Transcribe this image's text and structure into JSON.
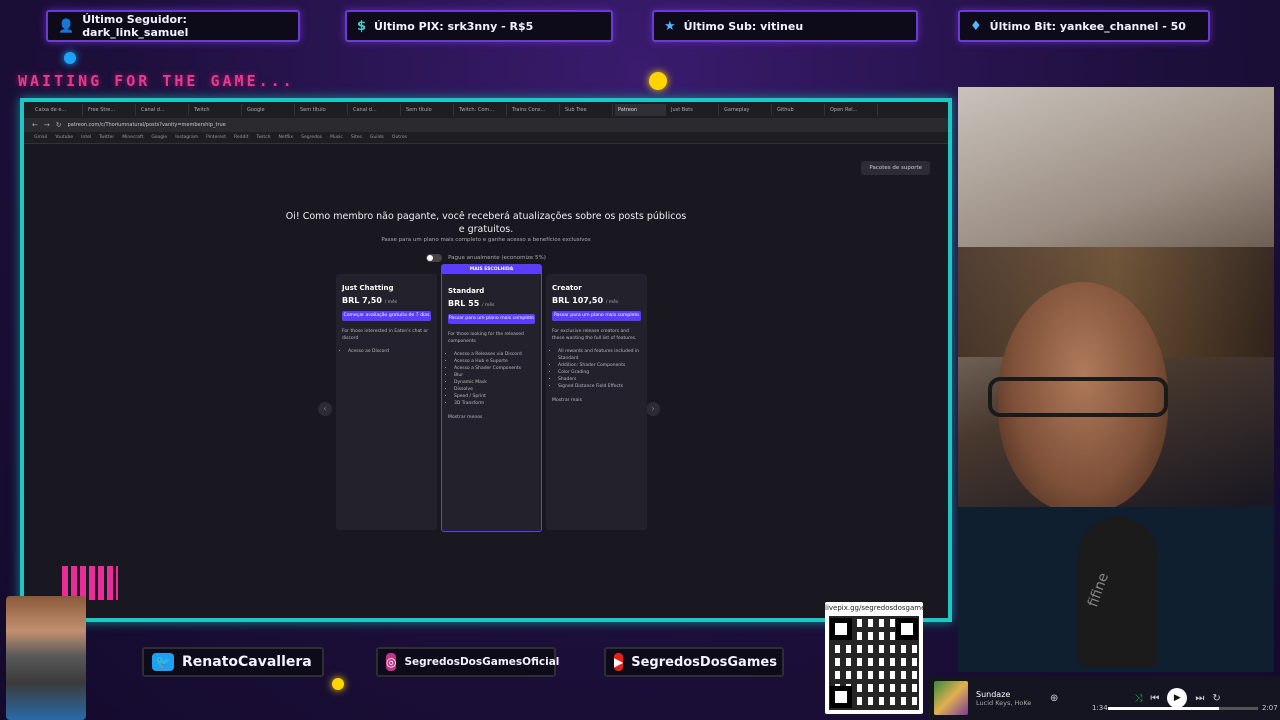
{
  "alerts": {
    "follower": "Último Seguidor: dark_link_samuel",
    "pix": "Último PIX: srk3nny - R$5",
    "sub": "Último Sub: vitineu",
    "bit": "Último Bit: yankee_channel - 50"
  },
  "waiting_text": "WAITING FOR THE GAME...",
  "browser": {
    "tabs": [
      "Caixa de e...",
      "Free Stre...",
      "Canal d...",
      "Twitch",
      "Google",
      "Sem título",
      "Canal d...",
      "Sem título",
      "Twitch: Com...",
      "Trains Cons...",
      "Sub Tree",
      "Patreon",
      "Just Bets",
      "Gameplay",
      "Github",
      "Open Rel..."
    ],
    "url": "patreon.com/c/Thoriumnatural/posts?vanity=membership_true",
    "bookmarks": [
      "Gmail",
      "Youtube",
      "Intel",
      "Twitter",
      "Minecraft",
      "Google",
      "Instagram",
      "Pinterest",
      "Reddit",
      "Twitch",
      "Netflix",
      "Segredos",
      "Music",
      "Sites",
      "Guilds",
      "Outros"
    ]
  },
  "page": {
    "top_button": "Pacotes de suporte",
    "headline_line1": "Oi! Como membro não pagante, você receberá atualizações sobre os posts públicos",
    "headline_line2": "e gratuitos.",
    "subline": "Passe para um plano mais completo e ganhe acesso a benefícios exclusivos",
    "toggle_label": "Pague anualmente (economize 5%)",
    "cards": [
      {
        "flag": "",
        "name": "Just Chatting",
        "price": "BRL 7,50",
        "per": "/ mês",
        "cta": "Começar avaliação gratuita de 7 dias",
        "desc": "For those interested in Eaton's chat or discord",
        "list": [
          "Acesso ao Discord"
        ],
        "more": ""
      },
      {
        "flag": "MAIS ESCOLHIDA",
        "name": "Standard",
        "price": "BRL 55",
        "per": "/ mês",
        "cta": "Passar para um plano mais completo",
        "desc": "For those looking for the released components",
        "list": [
          "Acesso a Releases via Discord",
          "Acesso a Hub e Suporte",
          "Acesso a Shader Components",
          "Blur",
          "Dynamic Mask",
          "Dissolve",
          "Speed / Sprint",
          "3D Transform"
        ],
        "more": "Mostrar menos"
      },
      {
        "flag": "",
        "name": "Creator",
        "price": "BRL 107,50",
        "per": "/ mês",
        "cta": "Passar para um plano mais completo",
        "desc": "For exclusive release creators and those wanting the full list of features.",
        "list": [
          "All rewards and features included in Standard",
          "Addition: Shader Components",
          "Color Grading",
          "Shaders",
          "Signed Distance Field Effects"
        ],
        "more": "Mostrar mais"
      }
    ]
  },
  "socials": {
    "twitter": "RenatoCavallera",
    "instagram": "SegredosDosGamesOficial",
    "youtube": "SegredosDosGames"
  },
  "qr_label": "livepix.gg/segredosdosgames",
  "player": {
    "title": "Sundaze",
    "artist": "Lucid Keys, HoKe",
    "elapsed": "1:34",
    "total": "2:07",
    "progress": 0.74
  },
  "webcam_text": "fifine"
}
